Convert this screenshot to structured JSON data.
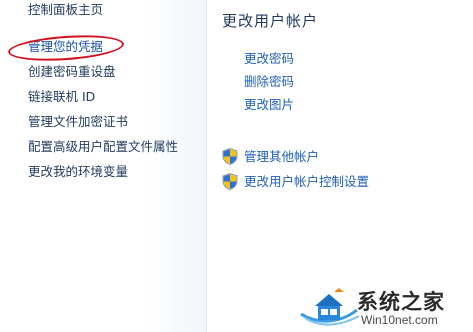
{
  "sidebar": {
    "items": [
      {
        "label": "控制面板主页"
      },
      {
        "label": "管理您的凭据"
      },
      {
        "label": "创建密码重设盘"
      },
      {
        "label": "链接联机 ID"
      },
      {
        "label": "管理文件加密证书"
      },
      {
        "label": "配置高级用户配置文件属性"
      },
      {
        "label": "更改我的环境变量"
      }
    ]
  },
  "main": {
    "title": "更改用户帐户",
    "tasks": [
      {
        "label": "更改密码"
      },
      {
        "label": "删除密码"
      },
      {
        "label": "更改图片"
      }
    ],
    "admin_tasks": [
      {
        "label": "管理其他帐户",
        "icon": "uac-shield-icon"
      },
      {
        "label": "更改用户帐户控制设置",
        "icon": "uac-shield-icon"
      }
    ]
  },
  "watermark": {
    "title": "系统之家",
    "url": "Win10net.com"
  },
  "colors": {
    "link": "#1f5fb5",
    "text": "#1e3a5c",
    "annotation": "#d1121c"
  }
}
